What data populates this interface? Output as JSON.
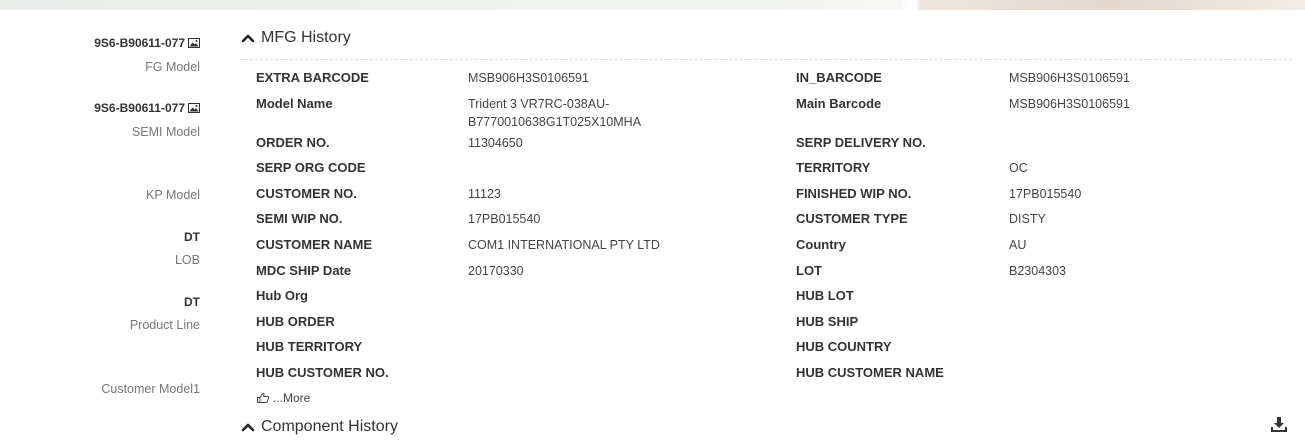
{
  "sidebar": {
    "items": [
      {
        "value": "9S6-B90611-077",
        "label": "FG Model",
        "has_image_icon": true
      },
      {
        "value": "9S6-B90611-077",
        "label": "SEMI Model",
        "has_image_icon": true
      },
      {
        "value": "",
        "label": "KP Model",
        "has_image_icon": false
      },
      {
        "value": "DT",
        "label": "LOB",
        "has_image_icon": false
      },
      {
        "value": "DT",
        "label": "Product Line",
        "has_image_icon": false
      },
      {
        "value": "",
        "label": "Customer Model1",
        "has_image_icon": false
      }
    ]
  },
  "mfg_history": {
    "title": "MFG History",
    "rows": [
      {
        "l1": "EXTRA BARCODE",
        "v1": "MSB906H3S0106591",
        "l2": "IN_BARCODE",
        "v2": "MSB906H3S0106591"
      },
      {
        "l1": "Model Name",
        "v1": "Trident 3 VR7RC-038AU-B7770010638G1T025X10MHA",
        "l2": "Main Barcode",
        "v2": "MSB906H3S0106591"
      },
      {
        "l1": "ORDER NO.",
        "v1": "11304650",
        "l2": "SERP DELIVERY NO.",
        "v2": ""
      },
      {
        "l1": "SERP ORG CODE",
        "v1": "",
        "l2": "TERRITORY",
        "v2": "OC"
      },
      {
        "l1": "CUSTOMER NO.",
        "v1": "11123",
        "l2": "FINISHED WIP NO.",
        "v2": "17PB015540"
      },
      {
        "l1": "SEMI WIP NO.",
        "v1": "17PB015540",
        "l2": "CUSTOMER TYPE",
        "v2": "DISTY"
      },
      {
        "l1": "CUSTOMER NAME",
        "v1": "COM1 INTERNATIONAL PTY LTD",
        "l2": "Country",
        "v2": "AU"
      },
      {
        "l1": "MDC SHIP Date",
        "v1": "20170330",
        "l2": "LOT",
        "v2": "B2304303"
      },
      {
        "l1": "Hub Org",
        "v1": "",
        "l2": "HUB LOT",
        "v2": ""
      },
      {
        "l1": "HUB ORDER",
        "v1": "",
        "l2": "HUB SHIP",
        "v2": ""
      },
      {
        "l1": "HUB TERRITORY",
        "v1": "",
        "l2": "HUB COUNTRY",
        "v2": ""
      },
      {
        "l1": "HUB CUSTOMER NO.",
        "v1": "",
        "l2": "HUB CUSTOMER NAME",
        "v2": ""
      }
    ],
    "more_label": "...More"
  },
  "component_history": {
    "title": "Component History"
  },
  "icons": {
    "expand_chevron": "chevron-up-icon",
    "image": "image-icon",
    "more": "hand-pointer-icon",
    "download": "download-icon"
  }
}
